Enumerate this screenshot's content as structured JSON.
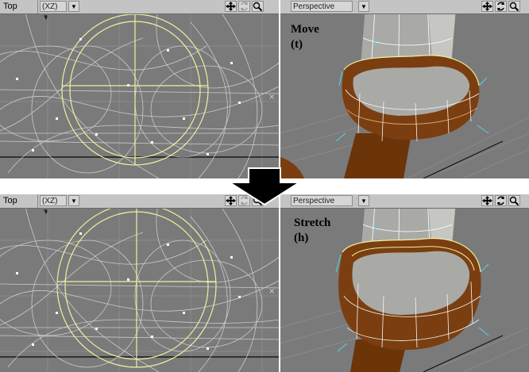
{
  "viewports": {
    "top_upper": {
      "view": "Top",
      "axis": "(XZ)"
    },
    "persp_upper": {
      "view": "Perspective",
      "tool": "Move",
      "key": "(t)"
    },
    "top_lower": {
      "view": "Top",
      "axis": "(XZ)"
    },
    "persp_lower": {
      "view": "Perspective",
      "tool": "Stretch",
      "key": "(h)"
    }
  },
  "colors": {
    "viewport_bg": "#7a7a7a",
    "header_bg": "#c4c4c4",
    "ring_highlight": "#f0f0a0",
    "wire": "#d8d8d8",
    "cylinder": "#a9aaa6",
    "cuff": "#7a3e10",
    "edge_cyan": "#4fd6e6",
    "transition_arrow": "#000000"
  },
  "icons": [
    "move-view-icon",
    "rotate-view-icon",
    "zoom-view-icon",
    "down-arrow-icon"
  ]
}
